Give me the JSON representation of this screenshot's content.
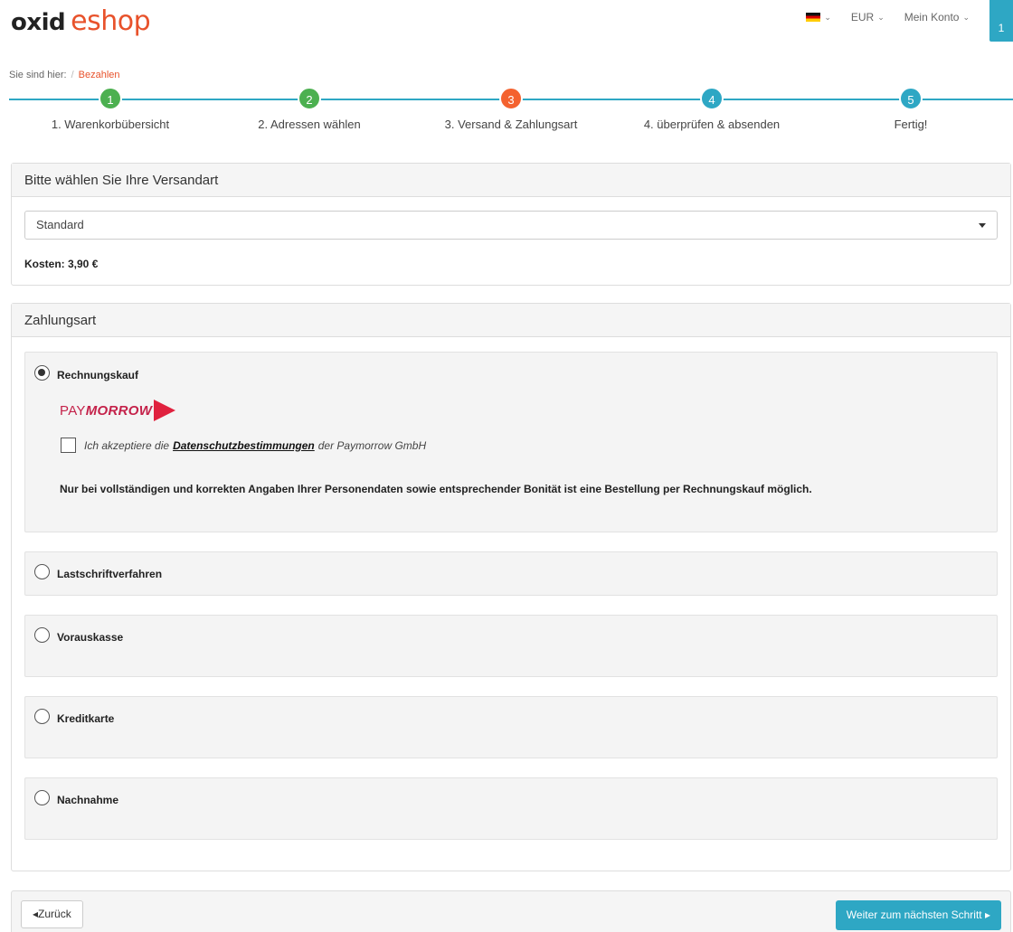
{
  "header": {
    "logo_primary": "oxid",
    "logo_secondary": "eshop",
    "language_flag": "german-flag-icon",
    "currency": "EUR",
    "account": "Mein Konto",
    "basket_count": "1"
  },
  "breadcrumb": {
    "prefix": "Sie sind hier:",
    "separator": "/",
    "current": "Bezahlen"
  },
  "steps": [
    {
      "number": "1",
      "label": "1. Warenkorbübersicht",
      "state": "done"
    },
    {
      "number": "2",
      "label": "2. Adressen wählen",
      "state": "done"
    },
    {
      "number": "3",
      "label": "3. Versand & Zahlungsart",
      "state": "active"
    },
    {
      "number": "4",
      "label": "4. überprüfen & absenden",
      "state": "todo"
    },
    {
      "number": "5",
      "label": "Fertig!",
      "state": "todo"
    }
  ],
  "shipping": {
    "title": "Bitte wählen Sie Ihre Versandart",
    "selected": "Standard",
    "cost": "Kosten: 3,90 €"
  },
  "payment": {
    "title": "Zahlungsart",
    "methods": [
      {
        "label": "Rechnungskauf",
        "checked": true
      },
      {
        "label": "Lastschriftverfahren",
        "checked": false
      },
      {
        "label": "Vorauskasse",
        "checked": false
      },
      {
        "label": "Kreditkarte",
        "checked": false
      },
      {
        "label": "Nachnahme",
        "checked": false
      }
    ],
    "paymorrow_logo_pay": "PAY",
    "paymorrow_logo_morrow": "MORROW",
    "consent_prefix": "Ich akzeptiere die",
    "consent_link": "Datenschutzbestimmungen",
    "consent_suffix": "der Paymorrow GmbH",
    "notice": "Nur bei vollständigen und korrekten Angaben Ihrer Personendaten sowie entsprechender Bonität ist eine Bestellung per Rechnungskauf möglich."
  },
  "footer": {
    "back_label": "Zurück",
    "next_label": "Weiter zum nächsten Schritt"
  },
  "colors": {
    "accent": "#2ea7c4",
    "brand": "#e8522b",
    "step_done": "#4cb050",
    "step_active": "#f4622f"
  }
}
